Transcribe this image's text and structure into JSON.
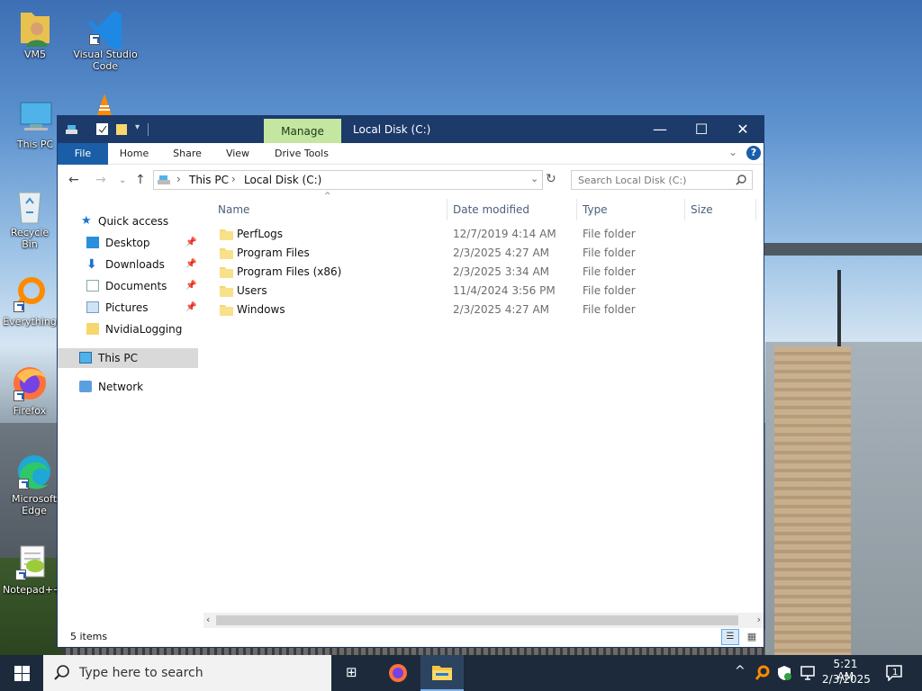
{
  "desktop": {
    "icons": [
      {
        "label": "VM5"
      },
      {
        "label": "Visual Studio Code"
      },
      {
        "label": "This PC"
      },
      {
        "label": "Recycle Bin"
      },
      {
        "label": "Everything"
      },
      {
        "label": "Firefox"
      },
      {
        "label": "Microsoft Edge"
      },
      {
        "label": "Notepad++"
      }
    ]
  },
  "window": {
    "title": "Local Disk (C:)",
    "context_tab": "Manage",
    "controls": {
      "minimize": "—",
      "maximize": "☐",
      "close": "✕"
    },
    "ribbon_tabs": [
      "File",
      "Home",
      "Share",
      "View",
      "Drive Tools"
    ],
    "breadcrumb": [
      "This PC",
      "Local Disk (C:)"
    ],
    "search_placeholder": "Search Local Disk (C:)",
    "sidebar": {
      "quick_access": "Quick access",
      "pinned": [
        "Desktop",
        "Downloads",
        "Documents",
        "Pictures"
      ],
      "other": "NvidiaLogging",
      "this_pc": "This PC",
      "network": "Network"
    },
    "columns": [
      "Name",
      "Date modified",
      "Type",
      "Size"
    ],
    "files": [
      {
        "name": "PerfLogs",
        "date": "12/7/2019 4:14 AM",
        "type": "File folder"
      },
      {
        "name": "Program Files",
        "date": "2/3/2025 4:27 AM",
        "type": "File folder"
      },
      {
        "name": "Program Files (x86)",
        "date": "2/3/2025 3:34 AM",
        "type": "File folder"
      },
      {
        "name": "Users",
        "date": "11/4/2024 3:56 PM",
        "type": "File folder"
      },
      {
        "name": "Windows",
        "date": "2/3/2025 4:27 AM",
        "type": "File folder"
      }
    ],
    "status": "5 items"
  },
  "taskbar": {
    "search_placeholder": "Type here to search",
    "time": "5:21 AM",
    "date": "2/3/2025",
    "notification_count": "1"
  },
  "colors": {
    "titlebar": "#1c3a6a",
    "manage_tab": "#c3e6a0",
    "file_tab": "#1a5ea8",
    "selected_nav": "#d9d9d9",
    "folder": "#f5d76e"
  }
}
